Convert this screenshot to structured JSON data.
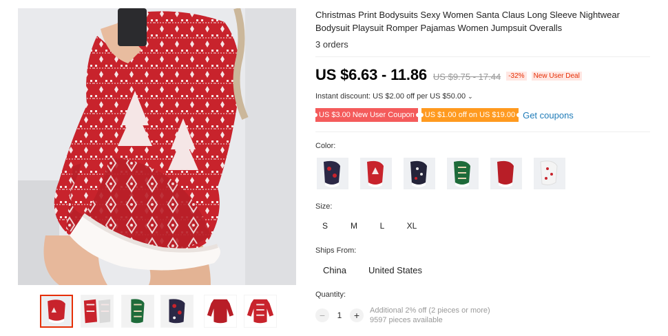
{
  "product": {
    "title": "Christmas Print Bodysuits Sexy Women Santa Claus Long Sleeve Nightwear Bodysuit Playsuit Romper Pajamas Women Jumpsuit Overalls",
    "orders": "3 orders"
  },
  "price": {
    "current": "US $6.63 - 11.86",
    "original": "US $9.75 - 17.44",
    "discount": "-32%",
    "deal_badge": "New User Deal"
  },
  "instant_discount": "Instant discount: US $2.00 off per US $50.00",
  "coupons": {
    "new_user": "US $3.00 New User Coupon",
    "store": "US $1.00 off on US $19.00",
    "get_label": "Get coupons"
  },
  "color": {
    "label": "Color:",
    "swatches": [
      "navy-reindeer",
      "red-christmas-tree",
      "navy-snowflake",
      "green-reindeer",
      "red-plain",
      "white-snowflake"
    ]
  },
  "size": {
    "label": "Size:",
    "options": [
      "S",
      "M",
      "L",
      "XL"
    ]
  },
  "ships_from": {
    "label": "Ships From:",
    "options": [
      "China",
      "United States"
    ]
  },
  "quantity": {
    "label": "Quantity:",
    "value": "1",
    "minus": "−",
    "plus": "+",
    "note": "Additional 2% off (2 pieces or more)",
    "available": "9597 pieces available"
  },
  "colors": {
    "accent": "#e62e04",
    "coupon_red": "#f45b5b",
    "coupon_orange": "#ff9a1f",
    "link": "#1e7bb8",
    "garment_red": "#c8232c"
  }
}
